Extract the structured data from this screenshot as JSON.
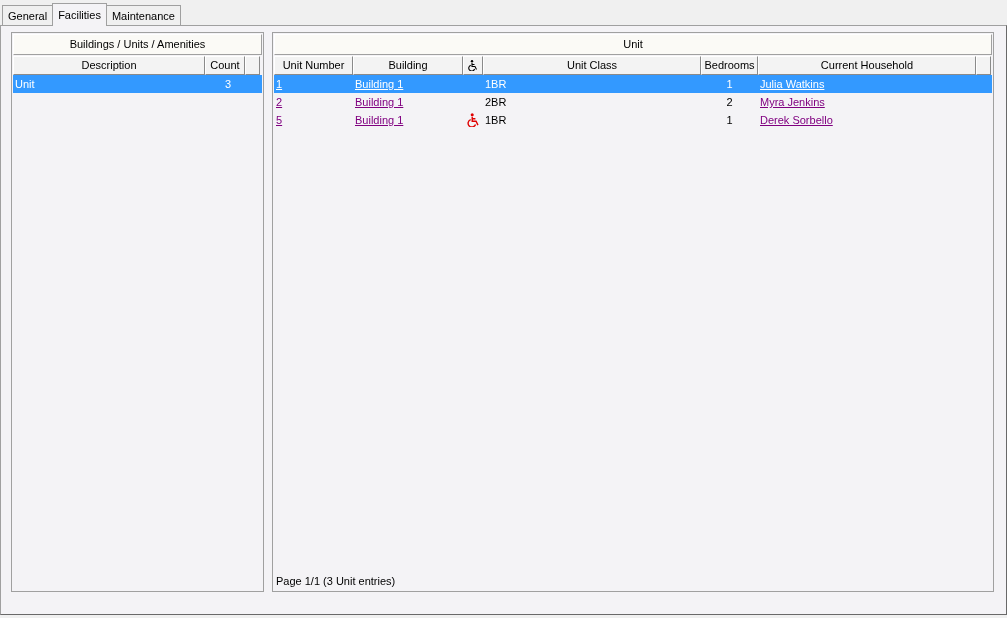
{
  "tabs": [
    {
      "label": "General",
      "selected": false
    },
    {
      "label": "Facilities",
      "selected": true
    },
    {
      "label": "Maintenance",
      "selected": false
    }
  ],
  "summary": {
    "title": "Buildings / Units / Amenities",
    "columns": [
      "Description",
      "Count"
    ],
    "rows": [
      {
        "description": "Unit",
        "count": "3",
        "selected": true
      }
    ]
  },
  "units": {
    "title": "Unit",
    "columns": [
      "Unit Number",
      "Building",
      "Unit Class",
      "Bedrooms",
      "Current Household"
    ],
    "rows": [
      {
        "unit_number": "1",
        "building": "Building 1",
        "accessible": false,
        "unit_class": "1BR",
        "bedrooms": "1",
        "household": "Julia Watkins",
        "selected": true
      },
      {
        "unit_number": "2",
        "building": "Building 1",
        "accessible": false,
        "unit_class": "2BR",
        "bedrooms": "2",
        "household": "Myra Jenkins",
        "selected": false
      },
      {
        "unit_number": "5",
        "building": "Building 1",
        "accessible": true,
        "unit_class": "1BR",
        "bedrooms": "1",
        "household": "Derek Sorbello",
        "selected": false
      }
    ],
    "footer": "Page 1/1 (3 Unit entries)"
  }
}
